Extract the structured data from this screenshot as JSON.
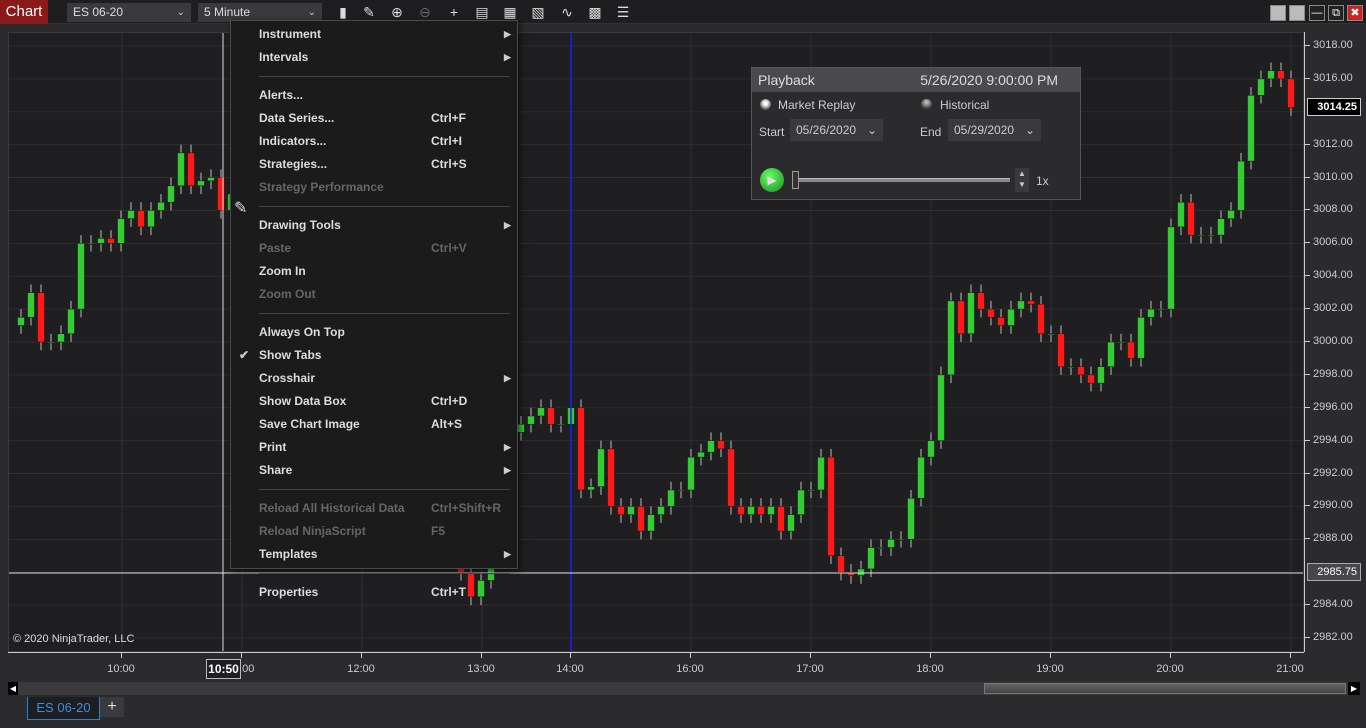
{
  "toolbar": {
    "title": "Chart",
    "instrument": "ES 06-20",
    "interval": "5 Minute",
    "icons": [
      "bar-chart-icon",
      "pencil-icon",
      "zoom-in-icon",
      "zoom-out-icon",
      "crosshair-icon",
      "data-box-icon",
      "properties-icon",
      "indicators-icon",
      "strategies-icon",
      "template-icon",
      "list-icon"
    ]
  },
  "menu": {
    "items": [
      {
        "label": "Instrument",
        "submenu": true
      },
      {
        "label": "Intervals",
        "submenu": true
      },
      {
        "sep": true
      },
      {
        "label": "Alerts..."
      },
      {
        "label": "Data Series...",
        "shortcut": "Ctrl+F"
      },
      {
        "label": "Indicators...",
        "shortcut": "Ctrl+I"
      },
      {
        "label": "Strategies...",
        "shortcut": "Ctrl+S"
      },
      {
        "label": "Strategy Performance",
        "disabled": true
      },
      {
        "sep": true
      },
      {
        "label": "Drawing Tools",
        "submenu": true
      },
      {
        "label": "Paste",
        "shortcut": "Ctrl+V",
        "disabled": true
      },
      {
        "label": "Zoom In"
      },
      {
        "label": "Zoom Out",
        "disabled": true
      },
      {
        "sep": true
      },
      {
        "label": "Always On Top"
      },
      {
        "label": "Show Tabs",
        "checked": true
      },
      {
        "label": "Crosshair",
        "submenu": true
      },
      {
        "label": "Show Data Box",
        "shortcut": "Ctrl+D"
      },
      {
        "label": "Save Chart Image",
        "shortcut": "Alt+S"
      },
      {
        "label": "Print",
        "submenu": true
      },
      {
        "label": "Share",
        "submenu": true
      },
      {
        "sep": true
      },
      {
        "label": "Reload All Historical Data",
        "shortcut": "Ctrl+Shift+R",
        "disabled": true
      },
      {
        "label": "Reload NinjaScript",
        "shortcut": "F5",
        "disabled": true
      },
      {
        "label": "Templates",
        "submenu": true
      },
      {
        "sep": true
      },
      {
        "label": "Properties",
        "shortcut": "Ctrl+T"
      }
    ]
  },
  "playback": {
    "title": "Playback",
    "time": "5/26/2020 9:00:00 PM",
    "market_replay": "Market Replay",
    "historical": "Historical",
    "mode": "Market Replay",
    "start_label": "Start",
    "start": "05/26/2020",
    "end_label": "End",
    "end": "05/29/2020",
    "speed": "1x",
    "progress": 0
  },
  "chart": {
    "copyright": "© 2020 NinjaTrader, LLC",
    "price_ticks": [
      "3018.00",
      "3016.00",
      "3012.00",
      "3010.00",
      "3008.00",
      "3006.00",
      "3004.00",
      "3002.00",
      "3000.00",
      "2998.00",
      "2996.00",
      "2994.00",
      "2992.00",
      "2990.00",
      "2988.00",
      "2984.00",
      "2982.00"
    ],
    "time_ticks": [
      "10:00",
      "11:00",
      "12:00",
      "13:00",
      "14:00",
      "16:00",
      "17:00",
      "18:00",
      "19:00",
      "20:00",
      "21:00"
    ],
    "last_price": "3014.25",
    "crosshair_price": "2985.75",
    "crosshair_time": "10:50",
    "up_color": "#33cc33",
    "down_color": "#ff1a1a",
    "closes": [
      3001.5,
      3003,
      3000,
      3000,
      3000.5,
      3002,
      3006,
      3006,
      3006.3,
      3006,
      3007.5,
      3008,
      3007,
      3008,
      3008.5,
      3009.5,
      3011.5,
      3009.5,
      3009.8,
      3010,
      3008,
      3009,
      3008.5,
      3007,
      3006,
      3005,
      3004,
      3003,
      3002,
      3001,
      3000,
      2999,
      2998,
      2997,
      2996,
      2995,
      2994,
      2993,
      2992,
      2991,
      2990,
      2989,
      2988,
      2987,
      2986,
      2984.5,
      2985.5,
      2990,
      2993,
      2994.5,
      2995,
      2995.5,
      2996,
      2995,
      2995,
      2996,
      2991,
      2991.2,
      2993.5,
      2990,
      2989.5,
      2990,
      2988.5,
      2989.5,
      2990,
      2991,
      2991,
      2993,
      2993.3,
      2994,
      2993.5,
      2990,
      2989.5,
      2990,
      2989.5,
      2990,
      2988.5,
      2989.5,
      2991,
      2991,
      2993,
      2987,
      2986,
      2985.8,
      2986.2,
      2987.5,
      2987.5,
      2988,
      2988,
      2990.5,
      2993,
      2994,
      2998,
      3002.5,
      3000.5,
      3003,
      3002,
      3001.5,
      3001,
      3002,
      3002.5,
      3002.3,
      3000.5,
      3000.5,
      2998.5,
      2998.5,
      2998,
      2997.5,
      2998.5,
      3000,
      3000,
      2999,
      3001.5,
      3002,
      3002,
      3007,
      3008.5,
      3006.5,
      3006.5,
      3006.5,
      3007.5,
      3008,
      3011,
      3015,
      3016,
      3016.5,
      3016,
      3014.25
    ]
  },
  "tabs": {
    "active": "ES 06-20",
    "add": "+"
  }
}
